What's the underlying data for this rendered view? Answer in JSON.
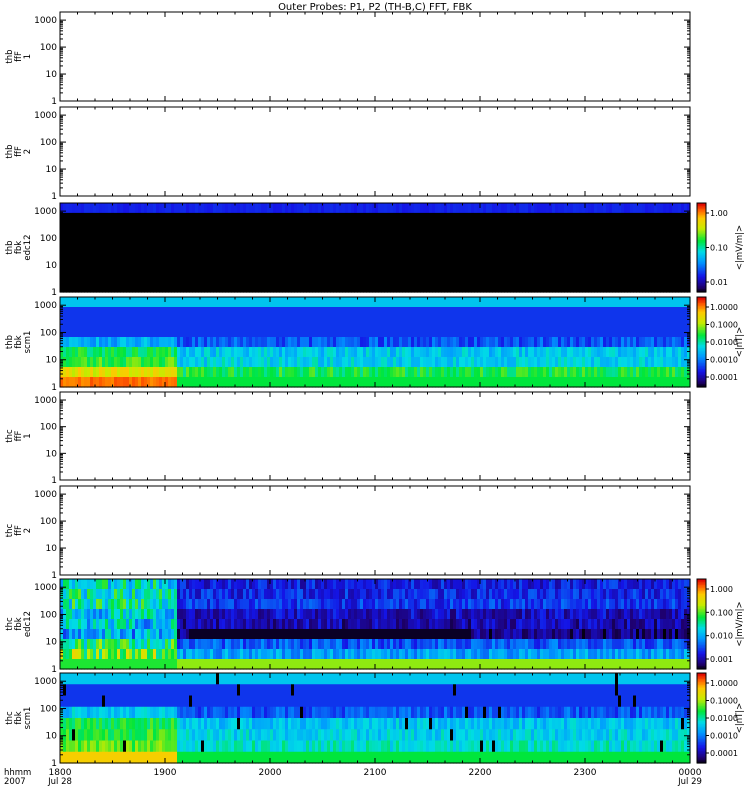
{
  "chart_data": {
    "type": "heatmap",
    "title": "Outer Probes: P1, P2 (TH-B,C) FFT, FBK",
    "x_axis": {
      "ticks": [
        "1800",
        "1900",
        "2000",
        "2100",
        "2200",
        "2300",
        "0000"
      ],
      "date_labels": {
        "start": "Jul 28",
        "end": "Jul 29"
      },
      "left_labels": [
        "hhmm",
        "2007"
      ]
    },
    "y_axis": {
      "scale": "log",
      "ticks": [
        "1",
        "10",
        "100",
        "1000"
      ],
      "range": [
        1,
        2000
      ]
    },
    "panels": [
      {
        "ylabel": [
          "thb",
          "ffF",
          "1"
        ],
        "empty": true
      },
      {
        "ylabel": [
          "thb",
          "ffF",
          "2"
        ],
        "empty": true
      },
      {
        "ylabel": [
          "thb",
          "fbk",
          "edc12"
        ],
        "empty": false,
        "profile": "mostly_black",
        "colorbar": {
          "ticks": [
            "1.00",
            "0.10",
            "0.01"
          ],
          "unit": "<|mV/m|>"
        }
      },
      {
        "ylabel": [
          "thb",
          "fbk",
          "scm1"
        ],
        "empty": false,
        "profile": "magnetic_b",
        "colorbar": {
          "ticks": [
            "1.0000",
            "0.1000",
            "0.0100",
            "0.0010",
            "0.0001"
          ],
          "unit": "<|nT|>"
        }
      },
      {
        "ylabel": [
          "thc",
          "ffF",
          "1"
        ],
        "empty": true
      },
      {
        "ylabel": [
          "thc",
          "ffF",
          "2"
        ],
        "empty": true
      },
      {
        "ylabel": [
          "thc",
          "fbk",
          "edc12"
        ],
        "empty": false,
        "profile": "electric_c",
        "colorbar": {
          "ticks": [
            "1.000",
            "0.100",
            "0.010",
            "0.001"
          ],
          "unit": "<|mV/m|>"
        }
      },
      {
        "ylabel": [
          "thc",
          "fbk",
          "scm1"
        ],
        "empty": false,
        "profile": "magnetic_c",
        "colorbar": {
          "ticks": [
            "1.0000",
            "0.1000",
            "0.0100",
            "0.0010",
            "0.0001"
          ],
          "unit": "<|nT|>"
        }
      }
    ]
  }
}
